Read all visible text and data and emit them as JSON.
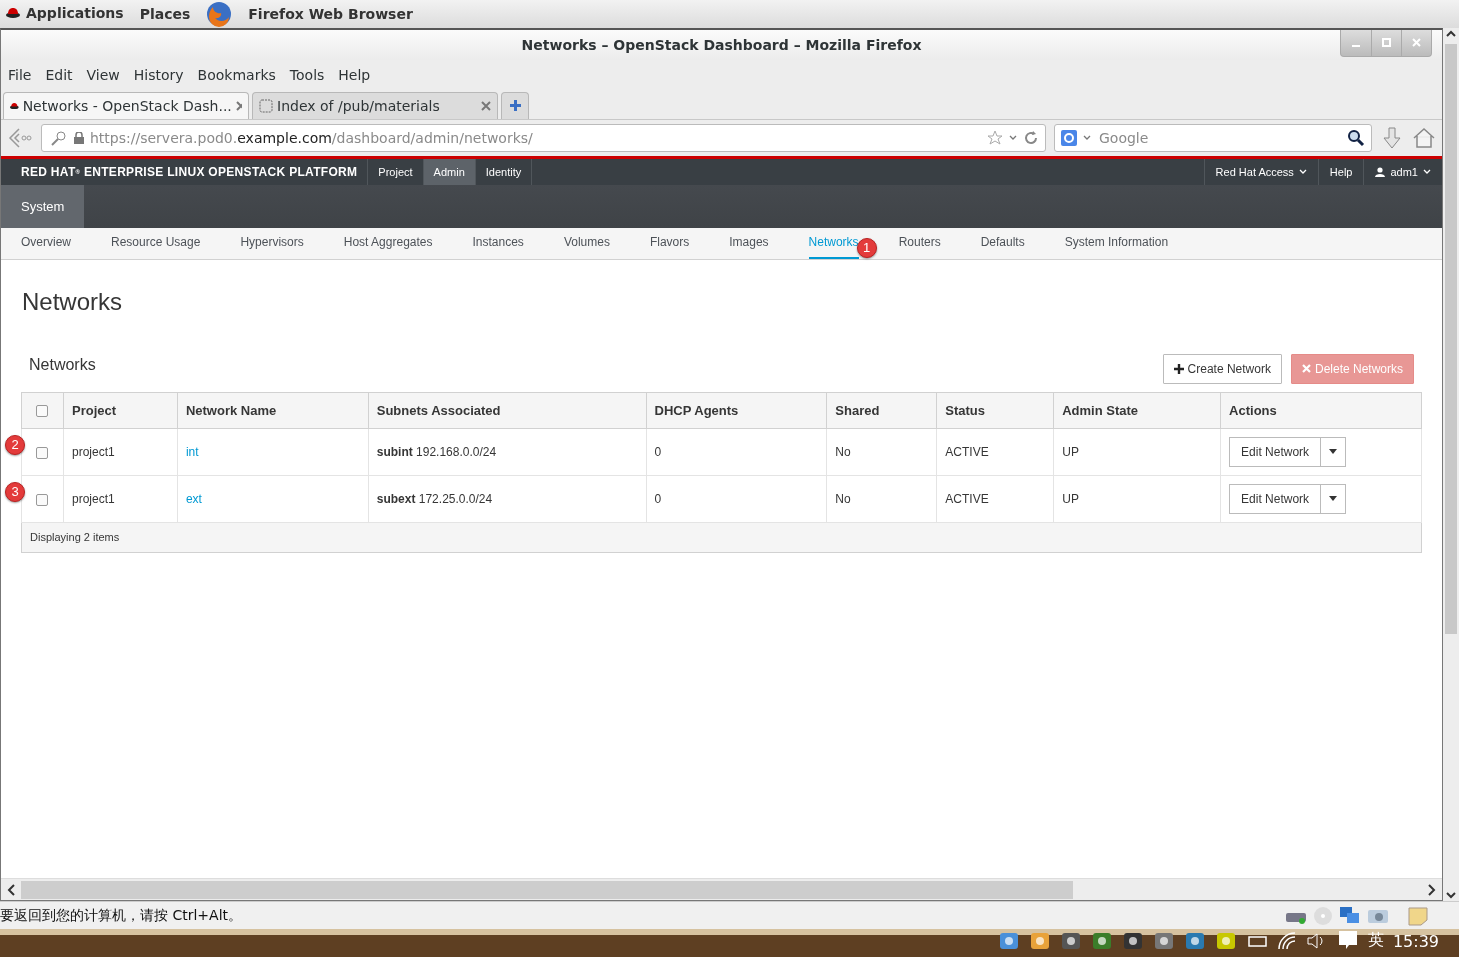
{
  "desktop_bar": {
    "menus": [
      "Applications",
      "Places"
    ],
    "app": "Firefox Web Browser"
  },
  "window": {
    "title": "Networks – OpenStack Dashboard – Mozilla Firefox"
  },
  "menu": [
    "File",
    "Edit",
    "View",
    "History",
    "Bookmarks",
    "Tools",
    "Help"
  ],
  "tabs": [
    {
      "label": "Networks - OpenStack Dash...",
      "selected": true
    },
    {
      "label": "Index of /pub/materials",
      "selected": false
    }
  ],
  "address": {
    "prefix": "https://servera.pod0.",
    "domain": "example.com",
    "path": "/dashboard/admin/networks/"
  },
  "search": {
    "placeholder": "Google"
  },
  "header": {
    "brand": "RED HAT",
    "brand_mark": "®",
    "brand_rest": "ENTERPRISE LINUX OPENSTACK PLATFORM",
    "dashboards": [
      {
        "label": "Project",
        "selected": false
      },
      {
        "label": "Admin",
        "selected": true
      },
      {
        "label": "Identity",
        "selected": false
      }
    ],
    "right": [
      {
        "label": "Red Hat Access",
        "kind": "dropdown"
      },
      {
        "label": "Help",
        "kind": "link"
      },
      {
        "label": "adm1",
        "kind": "user"
      }
    ]
  },
  "panel_groups": [
    {
      "label": "System",
      "selected": true
    }
  ],
  "nav": [
    {
      "label": "Overview",
      "selected": false
    },
    {
      "label": "Resource Usage",
      "selected": false
    },
    {
      "label": "Hypervisors",
      "selected": false
    },
    {
      "label": "Host Aggregates",
      "selected": false
    },
    {
      "label": "Instances",
      "selected": false
    },
    {
      "label": "Volumes",
      "selected": false
    },
    {
      "label": "Flavors",
      "selected": false
    },
    {
      "label": "Images",
      "selected": false
    },
    {
      "label": "Networks",
      "selected": true,
      "marker": "1"
    },
    {
      "label": "Routers",
      "selected": false
    },
    {
      "label": "Defaults",
      "selected": false
    },
    {
      "label": "System Information",
      "selected": false
    }
  ],
  "page_title": "Networks",
  "table": {
    "title": "Networks",
    "actions": [
      {
        "label": "Create Network",
        "kind": "create",
        "disabled": false
      },
      {
        "label": "Delete Networks",
        "kind": "delete",
        "disabled": true
      }
    ],
    "select_all": {
      "checked": false
    },
    "columns": [
      "Project",
      "Network Name",
      "Subnets Associated",
      "DHCP Agents",
      "Shared",
      "Status",
      "Admin State",
      "Actions"
    ],
    "rows": [
      {
        "marker": "2",
        "checked": false,
        "project": "project1",
        "name": "int",
        "subnets": "**subint** 192.168.0.0/24",
        "dhcp_agents": "0",
        "shared": "No",
        "status": "ACTIVE",
        "admin_state": "UP",
        "action": "Edit Network"
      },
      {
        "marker": "3",
        "checked": false,
        "project": "project1",
        "name": "ext",
        "subnets": "**subext** 172.25.0.0/24",
        "dhcp_agents": "0",
        "shared": "No",
        "status": "ACTIVE",
        "admin_state": "UP",
        "action": "Edit Network"
      }
    ],
    "footer": "Displaying 2 items"
  },
  "status_message": "要返回到您的计算机，请按 Ctrl+Alt。",
  "tray": {
    "input_method": "英",
    "time": "15:39"
  }
}
